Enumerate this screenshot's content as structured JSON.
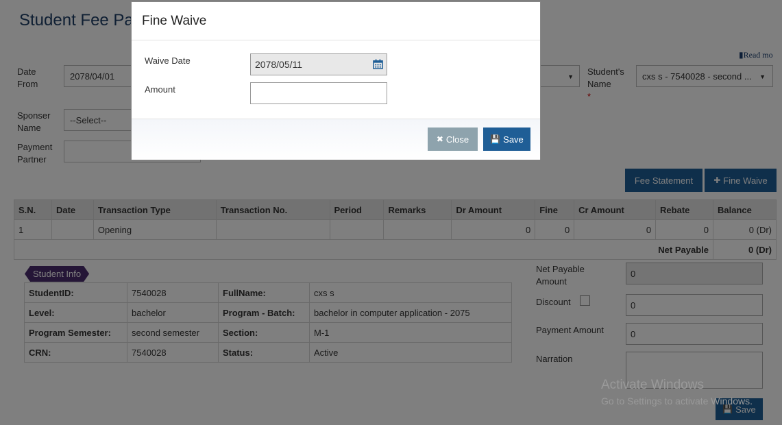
{
  "page": {
    "title": "Student Fee Pa",
    "read_more": "Read mo"
  },
  "filters": {
    "date_from_label": "Date\nFrom",
    "date_from_value": "2078/04/01",
    "student_name_label": "Student's\nName",
    "student_name_required": "*",
    "student_name_value": "cxs s - 7540028 - second ...",
    "sponser_label": "Sponser\nName",
    "sponser_value": "--Select--",
    "payment_partner_label": "Payment\nPartner"
  },
  "actions": {
    "fee_statement": "Fee Statement",
    "fine_waive": "Fine Waive"
  },
  "ledger": {
    "columns": [
      "S.N.",
      "Date",
      "Transaction Type",
      "Transaction No.",
      "Period",
      "Remarks",
      "Dr Amount",
      "Fine",
      "Cr Amount",
      "Rebate",
      "Balance"
    ],
    "rows": [
      [
        "1",
        "",
        "Opening",
        "",
        "",
        "",
        "0",
        "0",
        "0",
        "0",
        "0 (Dr)"
      ]
    ],
    "net_payable_label": "Net Payable",
    "net_payable_value": "0 (Dr)"
  },
  "student_info": {
    "badge": "Student Info",
    "rows": [
      [
        "StudentID:",
        "7540028",
        "FullName:",
        "cxs s"
      ],
      [
        "Level:",
        "bachelor",
        "Program - Batch:",
        "bachelor in computer application - 2075"
      ],
      [
        "Program Semester:",
        "second semester",
        "Section:",
        "M-1"
      ],
      [
        "CRN:",
        "7540028",
        "Status:",
        "Active"
      ]
    ]
  },
  "payment": {
    "net_payable_label": "Net Payable\nAmount",
    "net_payable_value": "0",
    "discount_label": "Discount",
    "discount_value": "0",
    "payment_amount_label": "Payment Amount",
    "payment_amount_value": "0",
    "narration_label": "Narration",
    "save_label": "Save"
  },
  "watermark": {
    "line1": "Activate Windows",
    "line2": "Go to Settings to activate Windows."
  },
  "modal": {
    "title": "Fine Waive",
    "waive_date_label": "Waive Date",
    "waive_date_value": "2078/05/11",
    "amount_label": "Amount",
    "amount_value": "",
    "close_label": "Close",
    "save_label": "Save"
  },
  "colors": {
    "primary": "#1f5e96",
    "secondary": "#8ea3ad",
    "badge": "#4a2c6e",
    "title": "#1f3f66"
  }
}
